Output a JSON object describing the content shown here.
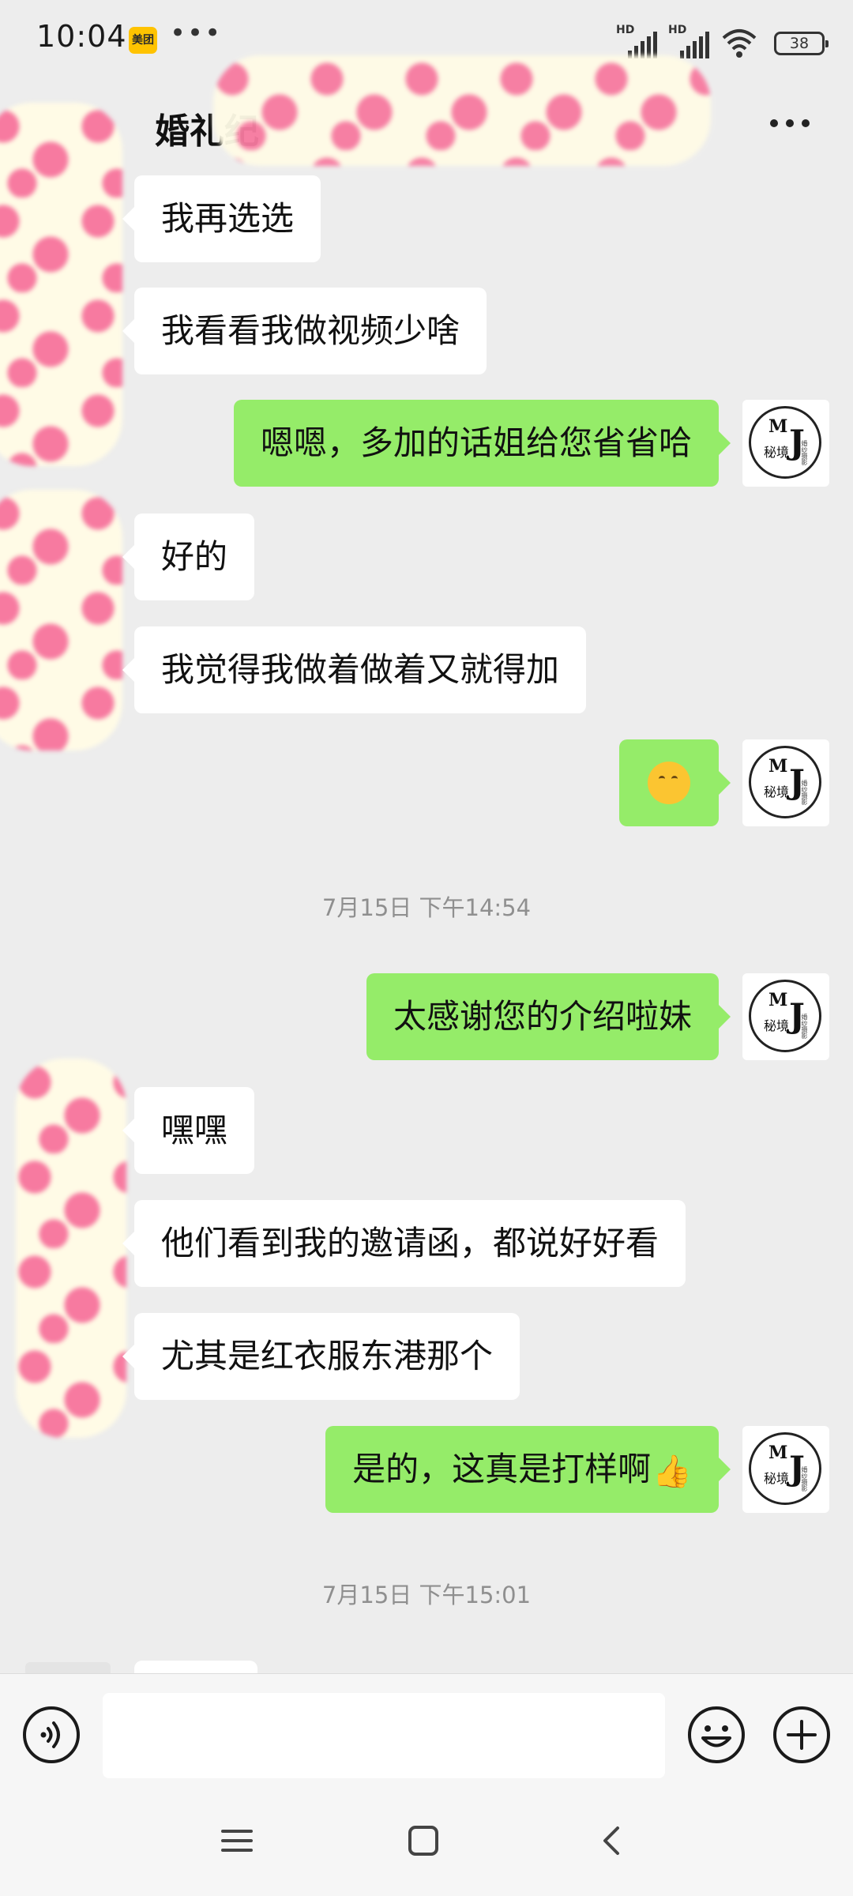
{
  "status_bar": {
    "time": "10:04",
    "app_badge": "美团",
    "more_dots": "•••",
    "signal1_label": "HD",
    "signal2_label": "HD",
    "battery": "38"
  },
  "header": {
    "title": "婚礼纪"
  },
  "messages": [
    {
      "side": "left",
      "text": "我再选选"
    },
    {
      "side": "left",
      "text": "我看看我做视频少啥"
    },
    {
      "side": "right",
      "text": "嗯嗯，多加的话姐给您省省哈"
    },
    {
      "side": "left",
      "text": "好的"
    },
    {
      "side": "left",
      "text": "我觉得我做着做着又就得加"
    },
    {
      "side": "right",
      "emoji": "hug-face"
    },
    {
      "side": "right",
      "text": "太感谢您的介绍啦妹"
    },
    {
      "side": "left",
      "text": "嘿嘿"
    },
    {
      "side": "left",
      "text": "他们看到我的邀请函，都说好好看"
    },
    {
      "side": "left",
      "text": "尤其是红衣服东港那个"
    },
    {
      "side": "right",
      "text": "是的，这真是打样啊",
      "emoji": "thumbs-up"
    }
  ],
  "timestamps": [
    "7月15日 下午14:54",
    "7月15日 下午15:01"
  ],
  "avatar": {
    "letters_m": "M",
    "letters_j": "J",
    "brand_cn": "秘境",
    "brand_small": "婚纱摄影"
  },
  "input": {
    "value": "",
    "placeholder": ""
  },
  "colors": {
    "background": "#ededed",
    "sent_bubble": "#95ec69",
    "received_bubble": "#ffffff"
  },
  "icons": [
    "back-icon",
    "more-icon",
    "voice-icon",
    "emoji-icon",
    "plus-icon",
    "menu-icon",
    "home-icon",
    "nav-back-icon"
  ]
}
